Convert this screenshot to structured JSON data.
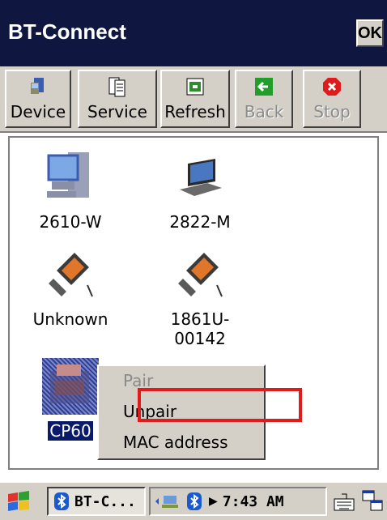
{
  "window": {
    "title": "BT-Connect",
    "ok_label": "OK"
  },
  "toolbar": {
    "buttons": [
      {
        "label": "Device",
        "icon": "device-icon",
        "enabled": true
      },
      {
        "label": "Service",
        "icon": "service-icon",
        "enabled": true
      },
      {
        "label": "Refresh",
        "icon": "refresh-icon",
        "enabled": true
      },
      {
        "label": "Back",
        "icon": "back-arrow-icon",
        "enabled": false
      },
      {
        "label": "Stop",
        "icon": "stop-icon",
        "enabled": false
      }
    ]
  },
  "devices": [
    {
      "label": "2610-W",
      "icon": "desktop-computer-icon"
    },
    {
      "label": "2822-M",
      "icon": "laptop-icon"
    },
    {
      "label": "Unknown",
      "icon": "pda-icon"
    },
    {
      "label": "1861U-\n00142",
      "icon": "pda-icon"
    },
    {
      "label": "CP60",
      "icon": "printer-icon",
      "selected": true
    }
  ],
  "context_menu": {
    "items": [
      {
        "label": "Pair",
        "enabled": false
      },
      {
        "label": "Unpair",
        "enabled": true
      },
      {
        "label": "MAC address",
        "enabled": true
      }
    ],
    "highlight_color": "#e01b1b"
  },
  "taskbar": {
    "task_label": "BT-C...",
    "clock": "7:43 AM",
    "icons": [
      "start-flag-icon",
      "bluetooth-icon",
      "network-icon",
      "keyboard-icon",
      "window-switch-icon"
    ]
  },
  "colors": {
    "titlebar": "#0f1640",
    "selection": "#0a1a6a",
    "face": "#d4d0c8"
  }
}
